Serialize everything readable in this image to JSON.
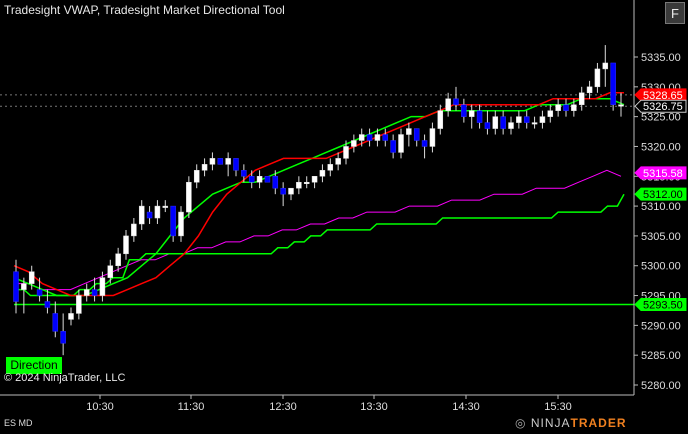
{
  "chart": {
    "title": "Tradesight VWAP, Tradesight Market Directional Tool",
    "copyright": "© 2024 NinjaTrader, LLC",
    "instrument": "ES MD",
    "direction_button": "Direction",
    "float_button": "F",
    "logo_left": "NINJA",
    "logo_right": "TRADER",
    "logo_mark": "◎",
    "colors": {
      "background": "#000000",
      "up_candle": "#ffffff",
      "down_candle": "#0000ff",
      "vwap": "#ff0000",
      "directional": "#00ff00",
      "magenta_band": "#ff00ff"
    }
  },
  "chart_data": {
    "type": "candlestick",
    "y_ticks": [
      "5335.00",
      "5330.00",
      "5325.00",
      "5320.00",
      "5315.00",
      "5310.00",
      "5305.00",
      "5300.00",
      "5295.00",
      "5290.00",
      "5285.00",
      "5280.00"
    ],
    "y_values": [
      5335,
      5330,
      5325,
      5320,
      5315,
      5310,
      5305,
      5300,
      5295,
      5290,
      5285,
      5280
    ],
    "x_ticks": [
      "10:30",
      "11:30",
      "12:30",
      "13:30",
      "14:30",
      "15:30"
    ],
    "ylim": [
      5278,
      5341
    ],
    "price_markers": [
      {
        "label": "5328.65",
        "value": 5328.65,
        "color": "#ff0000",
        "text": "#ffffff"
      },
      {
        "label": "5326.75",
        "value": 5326.75,
        "color": "#000000",
        "text": "#ffffff"
      },
      {
        "label": "5315.58",
        "value": 5315.58,
        "color": "#ff00ff",
        "text": "#ffffff"
      },
      {
        "label": "5312.00",
        "value": 5312.0,
        "color": "#00ff00",
        "text": "#000000"
      },
      {
        "label": "5293.50",
        "value": 5293.5,
        "color": "#00ff00",
        "text": "#000000"
      }
    ],
    "dashed_levels": [
      5328.65,
      5326.75
    ],
    "support_level": 5293.5,
    "candles": [
      [
        5299,
        5301,
        5292,
        5294
      ],
      [
        5296,
        5298,
        5292,
        5297
      ],
      [
        5297,
        5300,
        5296,
        5299
      ],
      [
        5296,
        5298,
        5294,
        5295
      ],
      [
        5294,
        5296,
        5292,
        5293
      ],
      [
        5292,
        5294,
        5288,
        5289
      ],
      [
        5289,
        5292,
        5285,
        5287
      ],
      [
        5291,
        5293,
        5290,
        5292
      ],
      [
        5292,
        5296,
        5291,
        5295
      ],
      [
        5295,
        5297,
        5294,
        5296
      ],
      [
        5296,
        5298,
        5294,
        5295
      ],
      [
        5295,
        5299,
        5294,
        5298
      ],
      [
        5298,
        5301,
        5297,
        5300
      ],
      [
        5300,
        5303,
        5299,
        5302
      ],
      [
        5302,
        5306,
        5301,
        5305
      ],
      [
        5305,
        5308,
        5304,
        5307
      ],
      [
        5307,
        5311,
        5306,
        5310
      ],
      [
        5309,
        5310,
        5307,
        5308
      ],
      [
        5308,
        5311,
        5307,
        5310
      ],
      [
        5310,
        5311,
        5309,
        5310
      ],
      [
        5310,
        5310,
        5304,
        5305
      ],
      [
        5305,
        5310,
        5304,
        5309
      ],
      [
        5309,
        5315,
        5308,
        5314
      ],
      [
        5314,
        5317,
        5313,
        5316
      ],
      [
        5316,
        5318,
        5315,
        5317
      ],
      [
        5317,
        5319,
        5316,
        5318
      ],
      [
        5318,
        5318,
        5317,
        5317
      ],
      [
        5317,
        5319,
        5315,
        5318
      ],
      [
        5318,
        5317,
        5315,
        5316
      ],
      [
        5316,
        5317,
        5314,
        5315
      ],
      [
        5315,
        5316,
        5313,
        5314
      ],
      [
        5314,
        5316,
        5313,
        5315
      ],
      [
        5315,
        5315,
        5314,
        5314
      ],
      [
        5315,
        5316,
        5312,
        5313
      ],
      [
        5313,
        5314,
        5310,
        5312
      ],
      [
        5312,
        5313,
        5311,
        5313
      ],
      [
        5313,
        5315,
        5312,
        5314
      ],
      [
        5314,
        5315,
        5313,
        5314
      ],
      [
        5314,
        5315,
        5313,
        5315
      ],
      [
        5315,
        5317,
        5314,
        5316
      ],
      [
        5316,
        5318,
        5315,
        5317
      ],
      [
        5317,
        5319,
        5316,
        5318
      ],
      [
        5318,
        5321,
        5317,
        5320
      ],
      [
        5320,
        5322,
        5319,
        5321
      ],
      [
        5321,
        5323,
        5320,
        5322
      ],
      [
        5322,
        5323,
        5320,
        5321
      ],
      [
        5321,
        5323,
        5320,
        5322
      ],
      [
        5322,
        5323,
        5320,
        5321
      ],
      [
        5321,
        5322,
        5318,
        5319
      ],
      [
        5319,
        5323,
        5318,
        5322
      ],
      [
        5322,
        5324,
        5320,
        5323
      ],
      [
        5323,
        5323,
        5320,
        5321
      ],
      [
        5321,
        5322,
        5318,
        5320
      ],
      [
        5320,
        5324,
        5319,
        5323
      ],
      [
        5323,
        5327,
        5322,
        5326
      ],
      [
        5326,
        5329,
        5325,
        5328
      ],
      [
        5328,
        5330,
        5326,
        5327
      ],
      [
        5327,
        5328,
        5324,
        5325
      ],
      [
        5325,
        5327,
        5323,
        5326
      ],
      [
        5326,
        5327,
        5323,
        5324
      ],
      [
        5324,
        5326,
        5322,
        5323
      ],
      [
        5323,
        5326,
        5322,
        5325
      ],
      [
        5325,
        5326,
        5322,
        5323
      ],
      [
        5323,
        5325,
        5322,
        5324
      ],
      [
        5324,
        5326,
        5323,
        5325
      ],
      [
        5325,
        5326,
        5323,
        5324
      ],
      [
        5324,
        5325,
        5323,
        5324
      ],
      [
        5324,
        5326,
        5323,
        5325
      ],
      [
        5325,
        5327,
        5324,
        5326
      ],
      [
        5326,
        5328,
        5325,
        5327
      ],
      [
        5327,
        5328,
        5325,
        5326
      ],
      [
        5326,
        5328,
        5325,
        5327
      ],
      [
        5327,
        5330,
        5326,
        5329
      ],
      [
        5329,
        5331,
        5328,
        5330
      ],
      [
        5330,
        5334,
        5329,
        5333
      ],
      [
        5333,
        5337,
        5330,
        5334
      ],
      [
        5334,
        5334,
        5326,
        5327
      ],
      [
        5327,
        5329,
        5325,
        5327
      ]
    ],
    "vwap_line": [
      5300,
      5299,
      5297,
      5296,
      5295,
      5295,
      5295,
      5295,
      5296,
      5297,
      5298,
      5300,
      5302,
      5305,
      5309,
      5312,
      5314,
      5316,
      5317,
      5318,
      5318,
      5318,
      5318,
      5319,
      5320,
      5321,
      5322,
      5323,
      5324,
      5325,
      5326,
      5327,
      5327,
      5327,
      5327,
      5327,
      5327,
      5327,
      5328,
      5328,
      5328,
      5328,
      5329,
      5329
    ],
    "green_line": [
      5298,
      5297,
      5296,
      5295,
      5295,
      5295,
      5296,
      5297,
      5298,
      5300,
      5302,
      5305,
      5308,
      5310,
      5312,
      5313,
      5314,
      5314,
      5315,
      5316,
      5317,
      5318,
      5319,
      5320,
      5321,
      5322,
      5323,
      5324,
      5325,
      5325,
      5326,
      5326,
      5326,
      5326,
      5326,
      5326,
      5326,
      5327,
      5327,
      5327,
      5328,
      5328,
      5328,
      5327
    ],
    "magenta_line": [
      5297,
      5297,
      5296,
      5296,
      5296,
      5297,
      5298,
      5299,
      5300,
      5301,
      5301,
      5302,
      5302,
      5303,
      5303,
      5304,
      5304,
      5305,
      5305,
      5306,
      5306,
      5307,
      5307,
      5308,
      5308,
      5309,
      5309,
      5309,
      5310,
      5310,
      5310,
      5311,
      5311,
      5311,
      5312,
      5312,
      5312,
      5313,
      5313,
      5313,
      5314,
      5315,
      5316,
      5315
    ],
    "directional_steps": [
      5296,
      5295,
      5295,
      5295,
      5296,
      5297,
      5298,
      5301,
      5302,
      5302,
      5302,
      5302,
      5302,
      5302,
      5302,
      5302,
      5303,
      5304,
      5305,
      5306,
      5306,
      5306,
      5307,
      5307,
      5307,
      5307,
      5308,
      5308,
      5308,
      5308,
      5308,
      5308,
      5308,
      5309,
      5309,
      5309,
      5310,
      5312
    ]
  }
}
